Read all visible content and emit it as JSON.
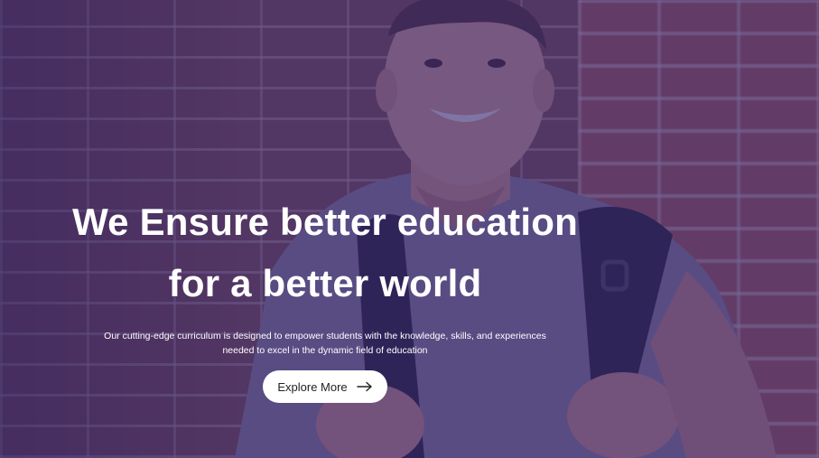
{
  "hero": {
    "title_line1": "We Ensure better education",
    "title_line2": "for a better world",
    "subtitle": "Our cutting-edge curriculum is designed to empower students with the knowledge, skills, and experiences needed to excel in the dynamic field of education",
    "cta_label": "Explore More",
    "cta_icon": "arrow-right-icon",
    "overlay_color": "#30206e"
  }
}
